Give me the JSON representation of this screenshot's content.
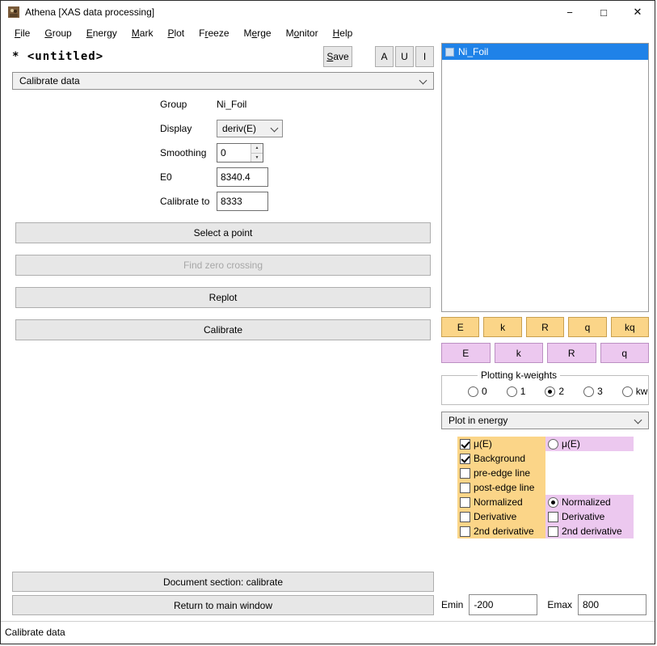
{
  "window": {
    "title": "Athena [XAS data processing]",
    "controls": {
      "minimize": "−",
      "maximize": "□",
      "close": "✕"
    },
    "status_bar": "Calibrate data"
  },
  "menu_bar": {
    "items": [
      {
        "pre": "",
        "mn": "F",
        "post": "ile"
      },
      {
        "pre": "",
        "mn": "G",
        "post": "roup"
      },
      {
        "pre": "",
        "mn": "E",
        "post": "nergy"
      },
      {
        "pre": "",
        "mn": "M",
        "post": "ark"
      },
      {
        "pre": "",
        "mn": "P",
        "post": "lot"
      },
      {
        "pre": "F",
        "mn": "r",
        "post": "eeze"
      },
      {
        "pre": "M",
        "mn": "e",
        "post": "rge"
      },
      {
        "pre": "M",
        "mn": "o",
        "post": "nitor"
      },
      {
        "pre": "",
        "mn": "H",
        "post": "elp"
      }
    ]
  },
  "header": {
    "project_label": "* <untitled>",
    "save_button": {
      "pre": "",
      "mn": "S",
      "post": "ave"
    },
    "mark_buttons": [
      "A",
      "U",
      "I"
    ]
  },
  "panel_selector": {
    "value": "Calibrate data"
  },
  "calibrate_form": {
    "group": {
      "label": "Group",
      "value": "Ni_Foil"
    },
    "display": {
      "label": "Display",
      "value": "deriv(E)"
    },
    "smoothing": {
      "label": "Smoothing",
      "value": "0"
    },
    "e0": {
      "label": "E0",
      "value": "8340.4"
    },
    "calibrate_to": {
      "label": "Calibrate to",
      "value": "8333"
    }
  },
  "action_buttons": {
    "select_point": {
      "label": "Select a point",
      "enabled": true
    },
    "find_zero": {
      "label": "Find zero crossing",
      "enabled": false
    },
    "replot": {
      "label": "Replot",
      "enabled": true
    },
    "calibrate": {
      "label": "Calibrate",
      "enabled": true
    }
  },
  "bottom_buttons": {
    "document": "Document section: calibrate",
    "return": "Return to main window"
  },
  "group_list": {
    "items": [
      {
        "label": "Ni_Foil",
        "selected": true,
        "marked": false
      }
    ]
  },
  "plot_buttons": {
    "current_group": [
      "E",
      "k",
      "R",
      "q",
      "kq"
    ],
    "marked_groups": [
      "E",
      "k",
      "R",
      "q"
    ]
  },
  "kweights": {
    "title": "Plotting k-weights",
    "options": [
      {
        "label": "0",
        "checked": false
      },
      {
        "label": "1",
        "checked": false
      },
      {
        "label": "2",
        "checked": true
      },
      {
        "label": "3",
        "checked": false
      },
      {
        "label": "kw",
        "checked": false
      }
    ]
  },
  "plot_space": {
    "value": "Plot in energy"
  },
  "plot_options": {
    "orange": [
      {
        "label": "μ(E)",
        "checked": true
      },
      {
        "label": "Background",
        "checked": true
      },
      {
        "label": "pre-edge line",
        "checked": false
      },
      {
        "label": "post-edge line",
        "checked": false
      },
      {
        "label": "Normalized",
        "checked": false
      },
      {
        "label": "Derivative",
        "checked": false
      },
      {
        "label": "2nd derivative",
        "checked": false
      }
    ],
    "purple_mu": {
      "label": "μ(E)",
      "checked": false
    },
    "purple": [
      {
        "label": "Normalized",
        "checked": true
      },
      {
        "label": "Derivative",
        "checked": false
      },
      {
        "label": "2nd derivative",
        "checked": false
      }
    ]
  },
  "energy_range": {
    "emin": {
      "label": "Emin",
      "value": "-200"
    },
    "emax": {
      "label": "Emax",
      "value": "800"
    }
  },
  "icons": {
    "spin_up": "▲",
    "spin_down": "▼"
  },
  "colors": {
    "selection_blue": "#1f82e8",
    "orange": "#fbd588",
    "purple": "#ecc8ef"
  }
}
